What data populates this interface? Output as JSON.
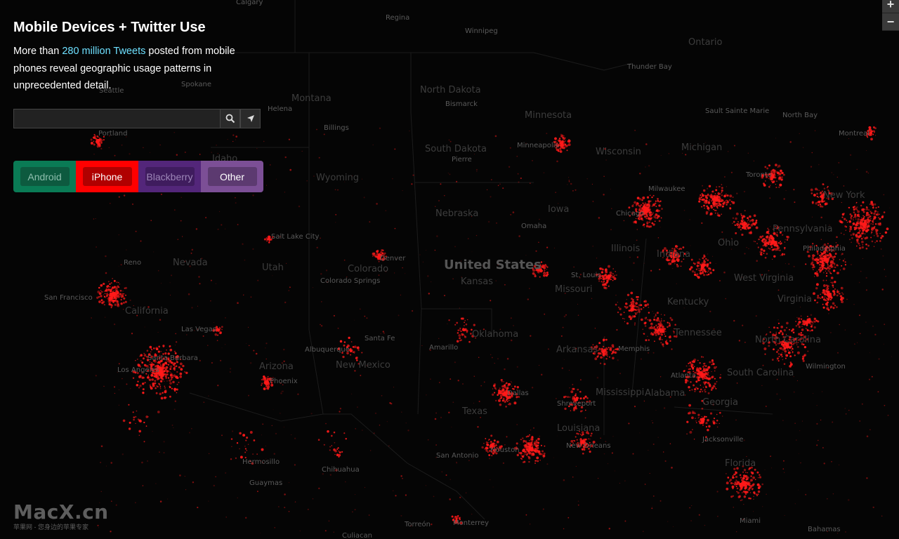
{
  "panel": {
    "title": "Mobile Devices + Twitter Use",
    "desc_before": "More than ",
    "desc_highlight": "280 million Tweets",
    "desc_after": " posted from mobile phones reveal geographic usage patterns in unprecedented detail.",
    "search_value": "",
    "search_placeholder": ""
  },
  "filters": [
    {
      "label": "Android",
      "tab_color": "#0a7b55",
      "btn_color": "#0d5a3f",
      "text_color": "#8fbfae"
    },
    {
      "label": "iPhone",
      "tab_color": "#ff0000",
      "btn_color": "#b00000",
      "text_color": "#ffffff"
    },
    {
      "label": "Blackberry",
      "tab_color": "#53267a",
      "btn_color": "#3f1c5e",
      "text_color": "#9d86b8"
    },
    {
      "label": "Other",
      "tab_color": "#7c4f96",
      "btn_color": "#5c3a70",
      "text_color": "#ffffff"
    }
  ],
  "zoom": {
    "in": "+",
    "out": "−"
  },
  "watermark": {
    "logo": "MacX.cn",
    "sub": "苹果网 - 您身边的苹果专家"
  },
  "colors": {
    "tweet_dot": "#ff1a1a",
    "accent": "#6ee0ff"
  },
  "map_labels": {
    "country": "United States",
    "states": [
      "Ontario",
      "North Dakota",
      "Montana",
      "Minnesota",
      "South Dakota",
      "Wisconsin",
      "Michigan",
      "Idaho",
      "Wyoming",
      "Nebraska",
      "Iowa",
      "Nevada",
      "Utah",
      "Colorado",
      "Kansas",
      "Missouri",
      "Illinois",
      "Indiana",
      "California",
      "Oklahoma",
      "Arkansas",
      "Arizona",
      "New Mexico",
      "Texas",
      "Mississippi",
      "Alabama",
      "Georgia",
      "Louisiana",
      "Kentucky",
      "Tennessee",
      "Ohio",
      "Pennsylvania",
      "West Virginia",
      "Virginia",
      "North Carolina",
      "South Carolina",
      "Florida",
      "New York"
    ],
    "cities": [
      "Calgary",
      "Regina",
      "Winnipeg",
      "Thunder Bay",
      "Spokane",
      "Seattle",
      "Helena",
      "Bismarck",
      "Sault Sainte Marie",
      "North Bay",
      "Montreal",
      "Portland",
      "Billings",
      "Minneapolis",
      "Pierre",
      "Toronto",
      "Milwaukee",
      "Chicago",
      "Omaha",
      "Salt Lake City",
      "Denver",
      "Reno",
      "Colorado Springs",
      "San Francisco",
      "St. Louis",
      "Las Vegas",
      "Santa Fe",
      "Albuquerque",
      "Amarillo",
      "Memphis",
      "Santa Barbara",
      "Los Angeles",
      "Phoenix",
      "Dallas",
      "Shreveport",
      "Atlanta",
      "Wilmington",
      "Houston",
      "San Antonio",
      "New Orleans",
      "Jacksonville",
      "Hermosillo",
      "Chihuahua",
      "Guaymas",
      "Torreón",
      "Monterrey",
      "Culiacan",
      "Miami",
      "Bahamas",
      "Philadelphia"
    ]
  }
}
